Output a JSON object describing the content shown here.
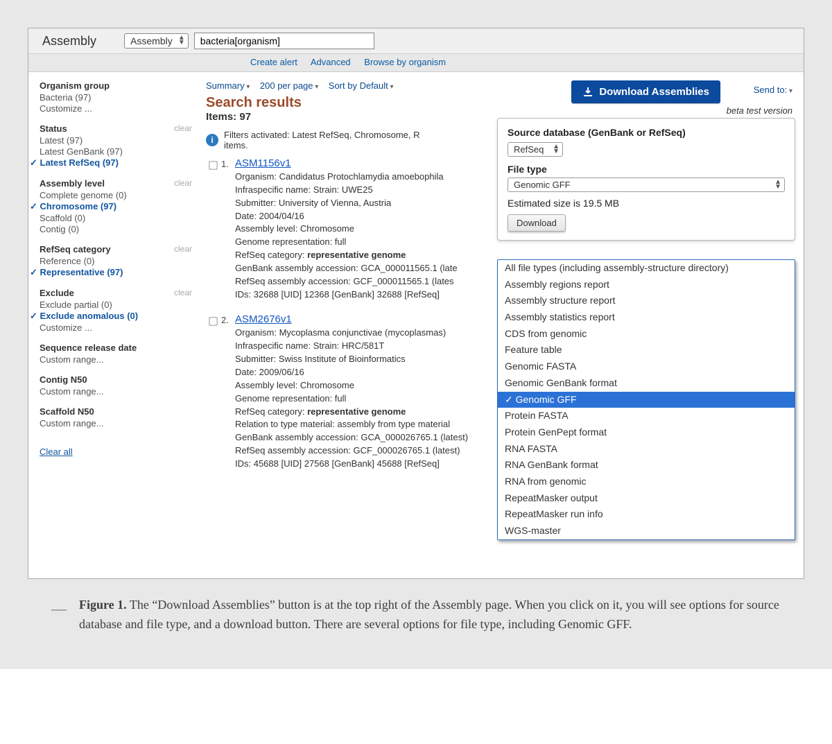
{
  "header": {
    "title": "Assembly",
    "db_select": "Assembly",
    "query": "bacteria[organism]",
    "links": {
      "create_alert": "Create alert",
      "advanced": "Advanced",
      "browse": "Browse by organism"
    }
  },
  "controls": {
    "display": "Summary",
    "per_page": "200 per page",
    "sort": "Sort by Default",
    "send_to": "Send to:",
    "download_btn": "Download Assemblies",
    "beta": "beta test version"
  },
  "dl_panel": {
    "source_lbl": "Source database (GenBank or RefSeq)",
    "source_val": "RefSeq",
    "file_type_lbl": "File type",
    "file_type_val": "Genomic GFF",
    "estimate": "Estimated size is 19.5 MB",
    "download": "Download"
  },
  "file_types": [
    "All file types (including assembly-structure directory)",
    "Assembly regions report",
    "Assembly structure report",
    "Assembly statistics report",
    "CDS from genomic",
    "Feature table",
    "Genomic FASTA",
    "Genomic GenBank format",
    "Genomic GFF",
    "Protein FASTA",
    "Protein GenPept format",
    "RNA FASTA",
    "RNA GenBank format",
    "RNA from genomic",
    "RepeatMasker output",
    "RepeatMasker run info",
    "WGS-master"
  ],
  "ft_selected_index": 8,
  "sidebar": {
    "organism_head": "Organism group",
    "org_bacteria": "Bacteria (97)",
    "customize": "Customize ...",
    "clear": "clear",
    "status_head": "Status",
    "latest": "Latest (97)",
    "latest_gb": "Latest GenBank (97)",
    "latest_rs": "Latest RefSeq (97)",
    "level_head": "Assembly level",
    "complete": "Complete genome (0)",
    "chromosome": "Chromosome (97)",
    "scaffold": "Scaffold (0)",
    "contig": "Contig (0)",
    "refseq_head": "RefSeq category",
    "reference": "Reference (0)",
    "representative": "Representative (97)",
    "exclude_head": "Exclude",
    "exclude_partial": "Exclude partial (0)",
    "exclude_anom": "Exclude anomalous (0)",
    "seq_date_head": "Sequence release date",
    "custom_range": "Custom range...",
    "contig_head": "Contig N50",
    "scaffold_n50_head": "Scaffold N50",
    "clear_all": "Clear all"
  },
  "results": {
    "header": "Search results",
    "items": "Items: 97",
    "filters_line": "Filters activated: Latest RefSeq, Chromosome, R",
    "filters_line2": "items.",
    "r1": {
      "title": "ASM1156v1",
      "organism": "Organism: Candidatus Protochlamydia amoebophila",
      "infra": "Infraspecific name: Strain: UWE25",
      "sub": "Submitter: University of Vienna, Austria",
      "date": "Date: 2004/04/16",
      "alevel": "Assembly level: Chromosome",
      "grep": "Genome representation: full",
      "refcat_pre": "RefSeq category: ",
      "refcat_b": "representative genome",
      "gba": "GenBank assembly accession: GCA_000011565.1 (late",
      "rsa": "RefSeq assembly accession: GCF_000011565.1 (lates",
      "ids": "IDs: 32688 [UID] 12368 [GenBank] 32688 [RefSeq]"
    },
    "r2": {
      "title": "ASM2676v1",
      "organism": "Organism: Mycoplasma conjunctivae (mycoplasmas)",
      "infra": "Infraspecific name: Strain: HRC/581T",
      "sub": "Submitter: Swiss Institute of Bioinformatics",
      "date": "Date: 2009/06/16",
      "alevel": "Assembly level: Chromosome",
      "grep": "Genome representation: full",
      "refcat_pre": "RefSeq category: ",
      "refcat_b": "representative genome",
      "reltype": "Relation to type material: assembly from type material",
      "gba": "GenBank assembly accession: GCA_000026765.1 (latest)",
      "rsa": "RefSeq assembly accession: GCF_000026765.1 (latest)",
      "ids": "IDs: 45688 [UID] 27568 [GenBank] 45688 [RefSeq]"
    }
  },
  "caption": {
    "label": "Figure 1.",
    "text": " The “Download Assemblies” button is at the top right of the Assembly page. When you click on it, you will see options for source database and file type, and a download button. There are several options for file type, including Genomic GFF."
  }
}
